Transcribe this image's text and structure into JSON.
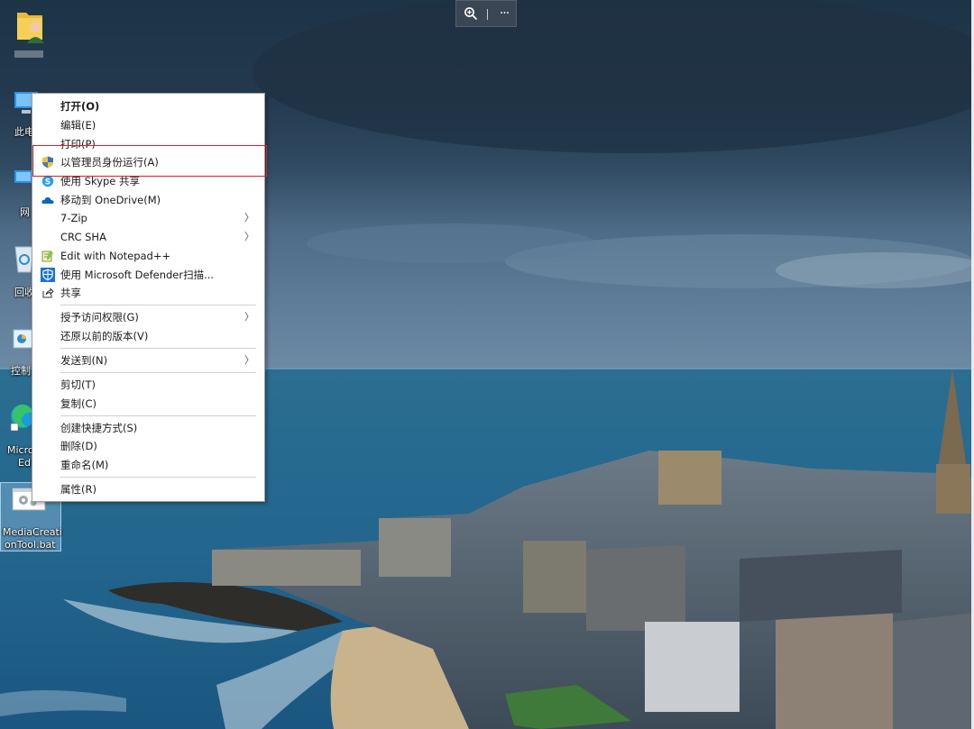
{
  "desktop": {
    "icons": [
      {
        "label": ""
      },
      {
        "label": "此电"
      },
      {
        "label": "网"
      },
      {
        "label": "回收"
      },
      {
        "label": "控制"
      },
      {
        "label": "Micro",
        "label2": "Ed"
      },
      {
        "label": "MediaCreati",
        "label2": "onTool.bat"
      }
    ]
  },
  "viewer_toolbar": {
    "zoom_icon": "zoom-in-icon",
    "more_label": "···"
  },
  "context_menu": {
    "items": [
      {
        "label": "打开(O)",
        "bold": true,
        "icon": ""
      },
      {
        "label": "编辑(E)",
        "icon": ""
      },
      {
        "label": "打印(P)",
        "icon": ""
      },
      {
        "label": "以管理员身份运行(A)",
        "icon": "uac-shield-icon"
      },
      {
        "label": "使用 Skype 共享",
        "icon": "skype-icon"
      },
      {
        "label": "移动到 OneDrive(M)",
        "icon": "onedrive-icon"
      },
      {
        "label": "7-Zip",
        "submenu": true,
        "icon": ""
      },
      {
        "label": "CRC SHA",
        "submenu": true,
        "icon": ""
      },
      {
        "label": "Edit with Notepad++",
        "icon": "notepad-plus-plus-icon"
      },
      {
        "label": "使用 Microsoft Defender扫描...",
        "icon": "defender-icon"
      },
      {
        "label": "共享",
        "icon": "share-icon"
      },
      {
        "label": "授予访问权限(G)",
        "submenu": true,
        "icon": ""
      },
      {
        "label": "还原以前的版本(V)",
        "icon": ""
      },
      {
        "label": "发送到(N)",
        "submenu": true,
        "icon": ""
      },
      {
        "label": "剪切(T)",
        "icon": ""
      },
      {
        "label": "复制(C)",
        "icon": ""
      },
      {
        "label": "创建快捷方式(S)",
        "icon": ""
      },
      {
        "label": "删除(D)",
        "icon": ""
      },
      {
        "label": "重命名(M)",
        "icon": ""
      },
      {
        "label": "属性(R)",
        "icon": ""
      }
    ],
    "highlighted_item": "以管理员身份运行(A)"
  },
  "colors": {
    "highlight_border": "#e01e2a",
    "menu_bg": "#ffffff",
    "accent_blue": "#1a73d9"
  }
}
